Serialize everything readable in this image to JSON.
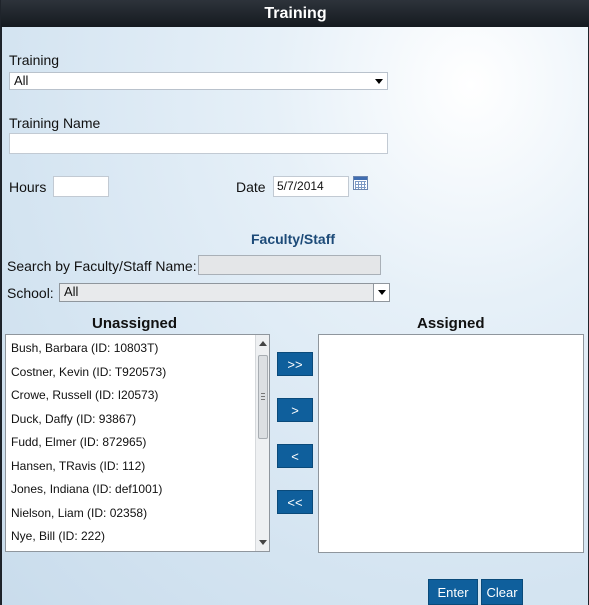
{
  "window": {
    "title": "Training"
  },
  "form": {
    "training_label": "Training",
    "training_value": "All",
    "training_name_label": "Training Name",
    "training_name_value": "",
    "hours_label": "Hours",
    "hours_value": "",
    "date_label": "Date",
    "date_value": "5/7/2014"
  },
  "faculty": {
    "section_title": "Faculty/Staff",
    "search_label": "Search by Faculty/Staff Name:",
    "search_value": "",
    "school_label": "School:",
    "school_value": "All"
  },
  "unassigned": {
    "heading": "Unassigned",
    "items": [
      "Bush, Barbara (ID: 10803T)",
      "Costner, Kevin (ID: T920573)",
      "Crowe, Russell (ID: I20573)",
      "Duck, Daffy (ID: 93867)",
      "Fudd, Elmer (ID: 872965)",
      "Hansen, TRavis (ID: 112)",
      "Jones, Indiana (ID: def1001)",
      "Nielson, Liam (ID: 02358)",
      "Nye, Bill (ID: 222)"
    ]
  },
  "assigned": {
    "heading": "Assigned",
    "items": []
  },
  "transfer": {
    "move_all_right": ">>",
    "move_right": ">",
    "move_left": "<",
    "move_all_left": "<<"
  },
  "actions": {
    "enter_label": "Enter",
    "clear_label": "Clear"
  },
  "colors": {
    "button_bg": "#0f5f9c",
    "section_title": "#1c4a78",
    "titlebar": "#1c2128"
  }
}
